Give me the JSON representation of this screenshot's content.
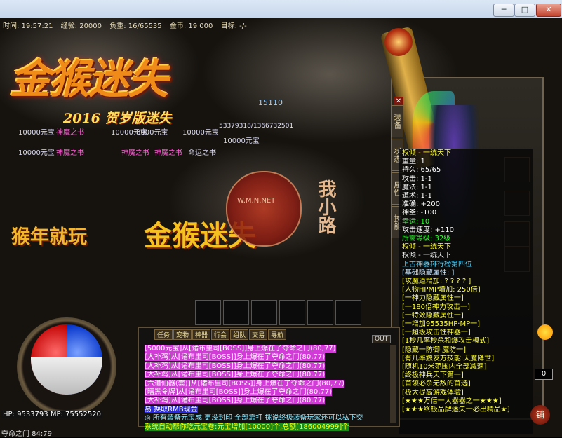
{
  "window": {
    "minimize": "─",
    "maximize": "□",
    "close": "✕"
  },
  "status": {
    "time": "时间: 19:57:21",
    "exp": "经验: 20000",
    "weight": "负重: 16/65535",
    "gold": "金币: 19 000",
    "target": "目标: -/-"
  },
  "logo": {
    "title": "金猴迷失",
    "subtitle": "2016 贺岁版迷失"
  },
  "coords_value": "15110",
  "hp_long": "53379318/1366732501",
  "items": [
    "10000元宝",
    "神魔之书",
    "10000元宝",
    "8000元宝",
    "10000元宝",
    "10000元宝",
    "神魔之书",
    "神魔之书",
    "神魔之书",
    "命运之书",
    "10000元宝"
  ],
  "slogan": {
    "left": "猴年就玩",
    "right": "金猴迷失"
  },
  "seal": {
    "vertical": "我小路",
    "inner": "W.M.N.NET"
  },
  "equip_tabs": [
    "装备",
    "状态",
    "属性",
    "技能"
  ],
  "tooltip": [
    {
      "t": "权倾 - 一统天下",
      "c": "y"
    },
    {
      "t": "重量: 1",
      "c": "w"
    },
    {
      "t": "持久: 65/65",
      "c": "w"
    },
    {
      "t": "攻击: 1-1",
      "c": "w"
    },
    {
      "t": "魔法: 1-1",
      "c": "w"
    },
    {
      "t": "道术: 1-1",
      "c": "w"
    },
    {
      "t": "准确: +200",
      "c": "w"
    },
    {
      "t": "神圣: -100",
      "c": "w"
    },
    {
      "t": "幸运: 10",
      "c": "g"
    },
    {
      "t": "攻击速度: +110",
      "c": "w"
    },
    {
      "t": "所需等级: 32级",
      "c": "g"
    },
    {
      "t": "权倾 - 一统天下",
      "c": "y"
    },
    {
      "t": "权倾 - 一统天下",
      "c": "w"
    },
    {
      "t": "上古神器排行榜第四位",
      "c": "c"
    },
    {
      "t": "[基础隐藏属性: ]",
      "c": "gy"
    },
    {
      "t": "[攻魔道增加: ? ? ? ? ]",
      "c": "y"
    },
    {
      "t": "[人物HPMP增加: 250倍]",
      "c": "y"
    },
    {
      "t": "[一神力隐藏属性一]",
      "c": "y"
    },
    {
      "t": "[一180倍神力攻击一]",
      "c": "y"
    },
    {
      "t": "[一特效隐藏属性一]",
      "c": "y"
    },
    {
      "t": "[一增加95535HP·MP一]",
      "c": "y"
    },
    {
      "t": "[一超级攻击性神器一]",
      "c": "y"
    },
    {
      "t": "[1秒几率秒杀和爆攻击模式]",
      "c": "y"
    },
    {
      "t": "[隐藏一防御·魔防一]",
      "c": "y"
    },
    {
      "t": "[有几率触发方技能:天魔降世]",
      "c": "y"
    },
    {
      "t": "[随机10米范围内全部减速]",
      "c": "y"
    },
    {
      "t": "[终极神兵天下第一]",
      "c": "y"
    },
    {
      "t": "[首领必杀无敌的首选]",
      "c": "y"
    },
    {
      "t": "[极大提高游戏体验]",
      "c": "y"
    },
    {
      "t": "[★★★万倍一大器器之一★★★]",
      "c": "y"
    },
    {
      "t": "[★★★终极品牌迷失一必出精品★]",
      "c": "y"
    }
  ],
  "orb": {
    "hp": "HP: 9533793",
    "mp": "MP: 75552520"
  },
  "map": "夺命之门 84:79",
  "chat_tabs": [
    "任务",
    "宠物",
    "神器",
    "行会",
    "组队",
    "交易",
    "导航"
  ],
  "chat_out": "OUT",
  "chat": [
    {
      "t": "[5000元宝]从[诸布里司[BOSS]]身上爆在了夺命之门(80,77)",
      "s": "pink"
    },
    {
      "t": "[大补鸡]从[诸布里司[BOSS]]身上爆在了夺命之门(80,77)",
      "s": "pink"
    },
    {
      "t": "[大补鸡]从[诸布里司[BOSS]]身上爆在了夺命之门(80,77)",
      "s": "pink"
    },
    {
      "t": "[大补鸡]从[诸布里司[BOSS]]身上爆在了夺命之门(80,77)",
      "s": "pink"
    },
    {
      "t": "[六道仙器(套)]从[诸布里司[BOSS]]身上爆在了夺命之门(80,77)",
      "s": "pink"
    },
    {
      "t": "[暗黑令牌]从[诸布里司[BOSS]]身上爆在了夺命之门(80,77)",
      "s": "pink"
    },
    {
      "t": "[大补鸡]从[诸布里司[BOSS]]身上爆在了夺命之门(80,77)",
      "s": "pink"
    },
    {
      "t": "易 换取RMB现金",
      "s": "blue"
    },
    {
      "t": "◎ 所有装备元宝成,更没封印 全部靠打 挑说终极装备玩家还可以私下交",
      "s": "cyanl"
    },
    {
      "t": "系统自动帮你吃元宝卷:元宝增加[10000]个,总额[186004999]个",
      "s": "sys"
    }
  ],
  "right_box": "0",
  "shop": "铺"
}
